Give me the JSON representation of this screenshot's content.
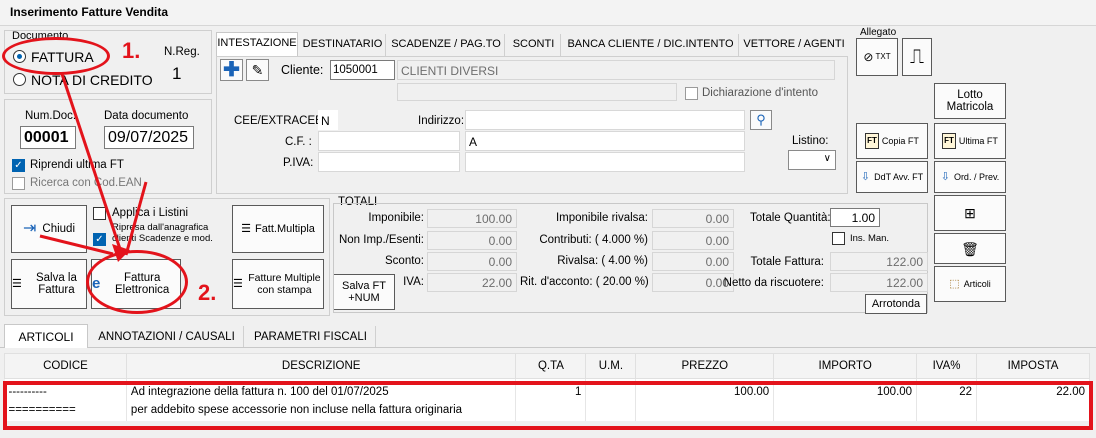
{
  "window": {
    "title": "Inserimento Fatture Vendita"
  },
  "documento": {
    "group_label": "Documento",
    "radio_fattura": "FATTURA",
    "radio_nota": "NOTA DI CREDITO",
    "nreg_label": "N.Reg.",
    "nreg_value": "1",
    "num_label": "Num.Doc.",
    "num_value": "00001",
    "data_label": "Data documento",
    "data_value": "09/07/2025",
    "riprendi_label": "Riprendi ultima FT",
    "ricerca_label": "Ricerca con Cod.EAN"
  },
  "annotations": {
    "n1": "1.",
    "n2": "2."
  },
  "tabs": [
    "INTESTAZIONE",
    "DESTINATARIO",
    "SCADENZE / PAG.TO",
    "SCONTI",
    "BANCA CLIENTE  / DIC.INTENTO",
    "VETTORE / AGENTI"
  ],
  "intestazione": {
    "cliente_label": "Cliente:",
    "cliente_code": "1050001",
    "cliente_name": "CLIENTI DIVERSI",
    "dich_label": "Dichiarazione d'intento",
    "cee_label": "CEE/EXTRACEE:",
    "cee_value": "N",
    "indirizzo_label": "Indirizzo:",
    "cf_label": "C.F. :",
    "cap_value": "A",
    "piva_label": "P.IVA:",
    "listino_label": "Listino:"
  },
  "allegato": {
    "label": "Allegato",
    "txt": "TXT"
  },
  "side_buttons": {
    "lotto": "Lotto Matricola",
    "copia": "Copia FT",
    "ultima": "Ultima FT",
    "ddt": "DdT Avv. FT",
    "ord": "Ord. / Prev.",
    "articoli": "Articoli"
  },
  "actions": {
    "chiudi": "Chiudi",
    "applica": "Applica i Listini",
    "ripresa": "Ripresa dall'anagrafica clienti Scadenze e mod.",
    "fatt_multipla": "Fatt.Multipla",
    "salva_fattura": "Salva la Fattura",
    "fattura_elettronica": "Fattura Elettronica",
    "fatture_multiple": "Fatture Multiple con stampa",
    "salva_ft_num": "Salva FT +NUM"
  },
  "totali": {
    "label": "TOTALI",
    "imponibile_label": "Imponibile:",
    "imponibile": "100.00",
    "nonimp_label": "Non Imp./Esenti:",
    "nonimp": "0.00",
    "sconto_label": "Sconto:",
    "sconto": "0.00",
    "iva_label": "IVA:",
    "iva": "22.00",
    "imp_rivalsa_label": "Imponibile rivalsa:",
    "imp_rivalsa": "0.00",
    "contributi_label": "Contributi:  ( 4.000 %)",
    "contributi": "0.00",
    "rivalsa_label": "Rivalsa:   ( 4.00 %)",
    "rivalsa": "0.00",
    "ritacc_label": "Rit. d'acconto:  ( 20.00 %)",
    "ritacc": "0.00",
    "totq_label": "Totale Quantità:",
    "totq": "1.00",
    "insman_label": "Ins. Man.",
    "totfatt_label": "Totale Fattura:",
    "totfatt": "122.00",
    "netto_label": "Netto da riscuotere:",
    "netto": "122.00",
    "arrotonda": "Arrotonda"
  },
  "bottom_tabs": [
    "ARTICOLI",
    "ANNOTAZIONI  / CAUSALI",
    "PARAMETRI FISCALI"
  ],
  "grid": {
    "headers": [
      "CODICE",
      "DESCRIZIONE",
      "Q.TA",
      "U.M.",
      "PREZZO",
      "IMPORTO",
      "IVA%",
      "IMPOSTA"
    ],
    "rows": [
      {
        "codice": "----------",
        "descrizione": "Ad integrazione della fattura n. 100 del 01/07/2025",
        "qta": "1",
        "um": "",
        "prezzo": "100.00",
        "importo": "100.00",
        "iva": "22",
        "imposta": "22.00"
      },
      {
        "codice": "==========",
        "descrizione": "per addebito spese accessorie non incluse nella fattura originaria",
        "qta": "",
        "um": "",
        "prezzo": "",
        "importo": "",
        "iva": "",
        "imposta": ""
      }
    ]
  }
}
